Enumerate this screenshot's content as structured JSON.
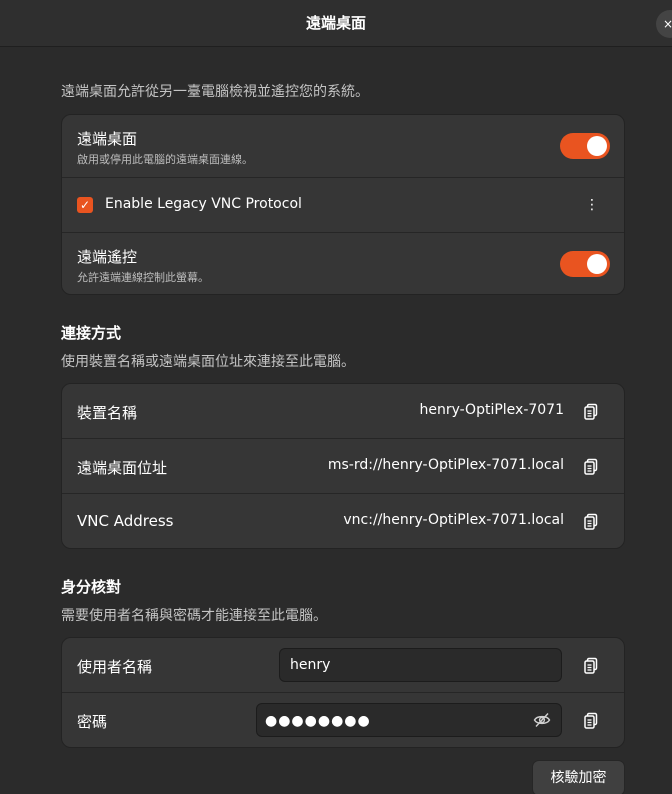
{
  "window": {
    "title": "遠端桌面",
    "close_label": "×"
  },
  "intro": "遠端桌面允許從另一臺電腦檢視並遙控您的系統。",
  "remote_desktop": {
    "title": "遠端桌面",
    "subtitle": "啟用或停用此電腦的遠端桌面連線。",
    "enabled": true
  },
  "legacy_vnc": {
    "label": "Enable Legacy VNC Protocol",
    "checked": true,
    "check_glyph": "✓",
    "menu_glyph": "⋮"
  },
  "remote_control": {
    "title": "遠端遙控",
    "subtitle": "允許遠端連線控制此螢幕。",
    "enabled": true
  },
  "connect": {
    "title": "連接方式",
    "description": "使用裝置名稱或遠端桌面位址來連接至此電腦。",
    "rows": [
      {
        "label": "裝置名稱",
        "value": "henry-OptiPlex-7071"
      },
      {
        "label": "遠端桌面位址",
        "value": "ms-rd://henry-OptiPlex-7071.local"
      },
      {
        "label": "VNC Address",
        "value": "vnc://henry-OptiPlex-7071.local"
      }
    ]
  },
  "auth": {
    "title": "身分核對",
    "description": "需要使用者名稱與密碼才能連接至此電腦。",
    "username_label": "使用者名稱",
    "username_value": "henry",
    "password_label": "密碼",
    "password_masked": "●●●●●●●●",
    "verify_button": "核驗加密"
  },
  "icons": {
    "copy": "copy-icon",
    "eye": "eye-hidden-icon",
    "close": "close-icon",
    "kebab": "more-options-icon"
  },
  "colors": {
    "accent": "#e95420",
    "background": "#2b2b2b",
    "card": "#363636"
  }
}
